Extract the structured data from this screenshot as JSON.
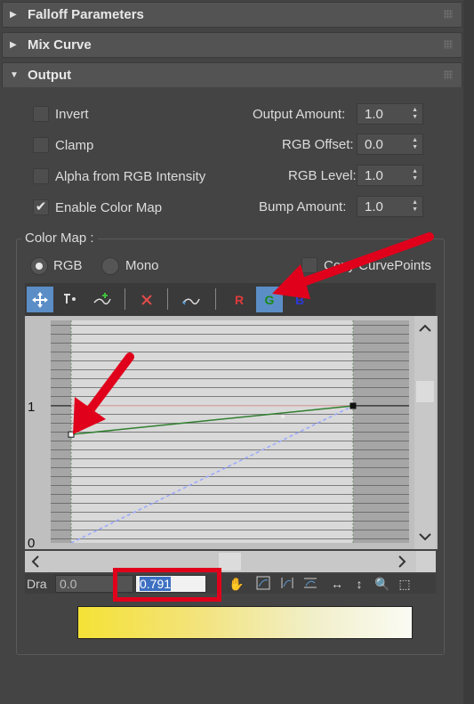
{
  "rollouts": [
    {
      "title": "Falloff Parameters",
      "state": "collapsed"
    },
    {
      "title": "Mix Curve",
      "state": "collapsed"
    },
    {
      "title": "Output",
      "state": "expanded"
    }
  ],
  "output": {
    "invert_label": "Invert",
    "clamp_label": "Clamp",
    "alpha_label": "Alpha from RGB Intensity",
    "enable_color_map_label": "Enable Color Map",
    "output_amount_label": "Output Amount:",
    "output_amount_value": "1.0",
    "rgb_offset_label": "RGB Offset:",
    "rgb_offset_value": "0.0",
    "rgb_level_label": "RGB Level:",
    "rgb_level_value": "1.0",
    "bump_amount_label": "Bump Amount:",
    "bump_amount_value": "1.0",
    "checkbox_states": {
      "invert": false,
      "clamp": false,
      "alpha": false,
      "enable_color_map": true
    }
  },
  "color_map": {
    "group_title": "Color Map :",
    "rgb_label": "RGB",
    "mono_label": "Mono",
    "copy_label": "Copy CurvePoints",
    "mode": "RGB",
    "channel_r": "R",
    "channel_g": "G",
    "channel_b": "B",
    "active_channel": "G",
    "y_tick_top": "1",
    "y_tick_bottom": "0",
    "drag_label": "Dra",
    "drag_x_value": "0.0",
    "drag_y_value": "0.791"
  },
  "curve": {
    "green": {
      "points": [
        [
          0.0,
          0.791
        ],
        [
          1.0,
          1.0
        ]
      ],
      "color": "#2f7f2f"
    },
    "red": {
      "points": [
        [
          0.0,
          1.0
        ],
        [
          1.0,
          1.0
        ]
      ],
      "color": "#e8b7b7"
    },
    "blue": {
      "points": [
        [
          0.0,
          0.0
        ],
        [
          1.0,
          1.0
        ]
      ],
      "color": "#9aa8ff"
    }
  },
  "colors": {
    "annotation_red": "#e0001b",
    "active_button_blue": "#5b8ec7",
    "gradient_start": "#f4e236",
    "gradient_end": "#fbfbf4"
  }
}
